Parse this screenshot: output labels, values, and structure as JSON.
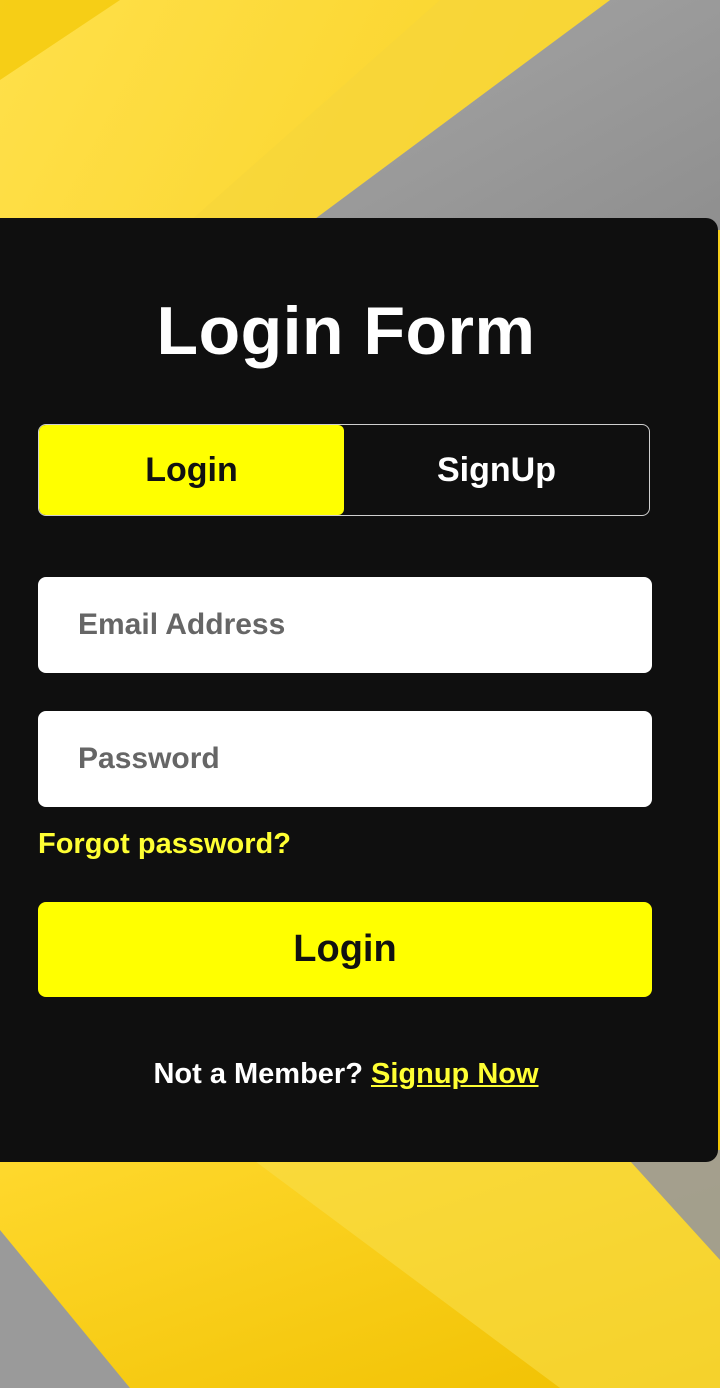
{
  "colors": {
    "accent_yellow": "#ffff00",
    "card_background": "#0f0f0f",
    "background_yellow": "#f6d21e",
    "background_gray": "#9a9a9a",
    "input_background": "#ffffff",
    "link_yellow": "#ffff33"
  },
  "form": {
    "title": "Login Form",
    "tabs": [
      {
        "label": "Login",
        "active": true
      },
      {
        "label": "SignUp",
        "active": false
      }
    ],
    "email_placeholder": "Email Address",
    "email_value": "",
    "password_placeholder": "Password",
    "password_value": "",
    "forgot_password_label": "Forgot password?",
    "submit_label": "Login",
    "footer_text": "Not a Member?",
    "footer_link_label": "Signup Now"
  }
}
